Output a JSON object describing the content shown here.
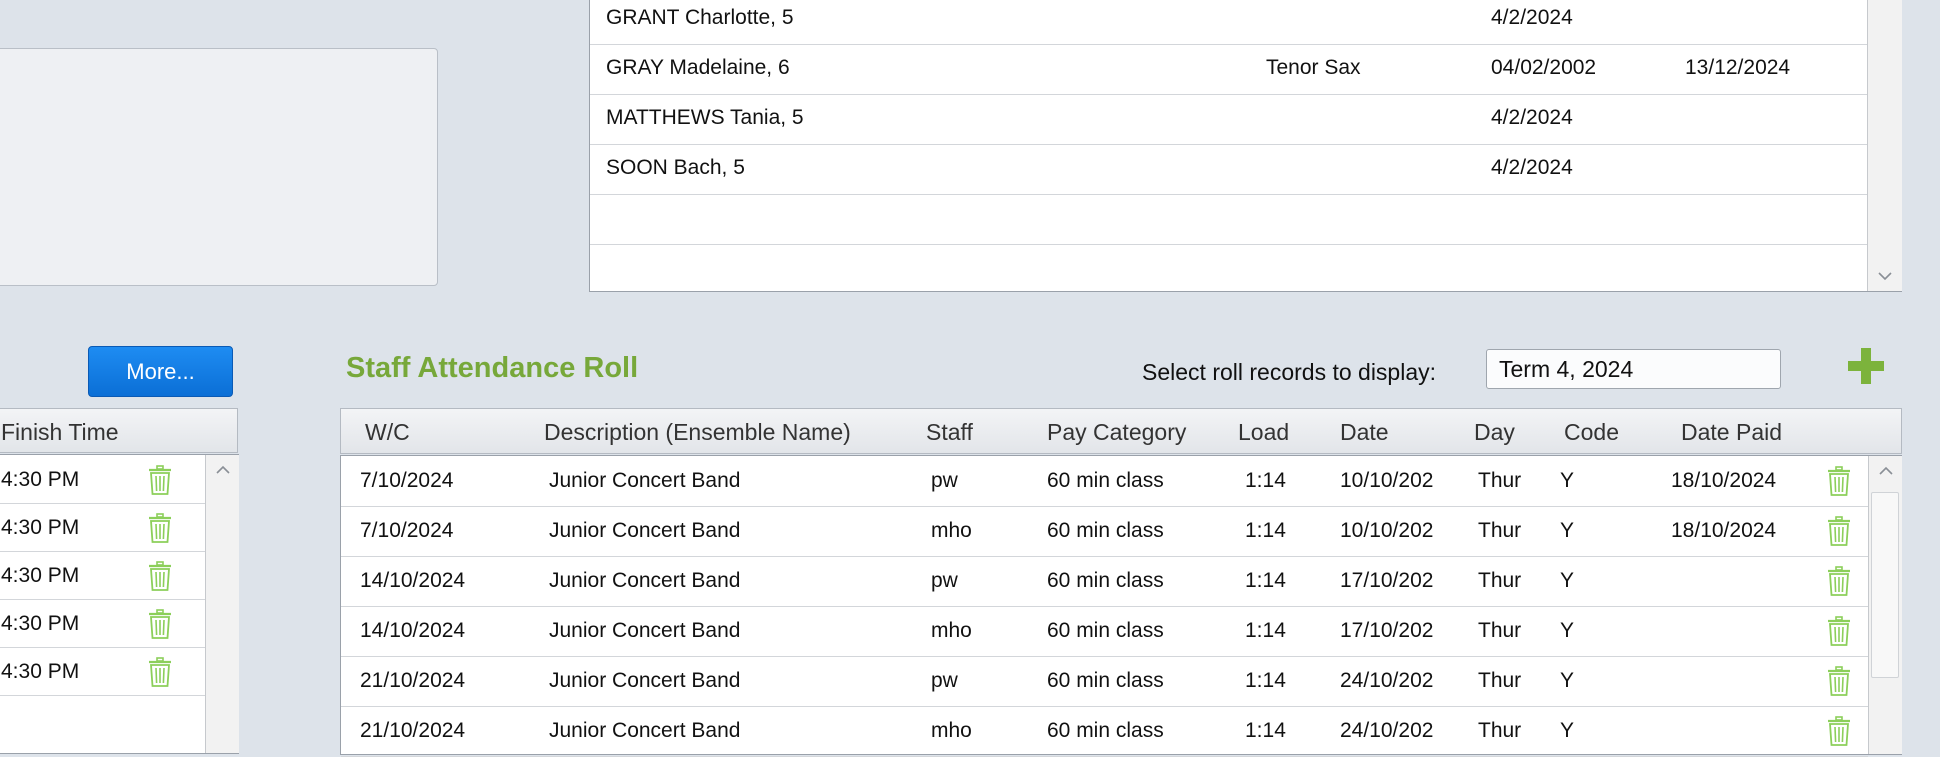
{
  "students": [
    {
      "name": "GRANT Charlotte, 5",
      "instrument": "",
      "start": "4/2/2024",
      "end": ""
    },
    {
      "name": "GRAY Madelaine, 6",
      "instrument": "Tenor Sax",
      "start": "04/02/2002",
      "end": "13/12/2024"
    },
    {
      "name": "MATTHEWS Tania, 5",
      "instrument": "",
      "start": "4/2/2024",
      "end": ""
    },
    {
      "name": "SOON Bach, 5",
      "instrument": "",
      "start": "4/2/2024",
      "end": ""
    }
  ],
  "more_button": "More...",
  "section_title": "Staff Attendance Roll",
  "filter": {
    "label": "Select roll records to display:",
    "value": "Term 4, 2024"
  },
  "left_table": {
    "header": "Finish Time",
    "rows": [
      "4:30 PM",
      "4:30 PM",
      "4:30 PM",
      "4:30 PM",
      "4:30 PM"
    ]
  },
  "roll_table": {
    "headers": [
      "W/C",
      "Description (Ensemble Name)",
      "Staff",
      "Pay Category",
      "Load",
      "Date",
      "Day",
      "Code",
      "Date Paid"
    ],
    "rows": [
      {
        "wc": "7/10/2024",
        "desc": "Junior Concert Band",
        "staff": "pw",
        "pay": "60 min class",
        "load": "1:14",
        "date": "10/10/202",
        "day": "Thur",
        "code": "Y",
        "paid": "18/10/2024"
      },
      {
        "wc": "7/10/2024",
        "desc": "Junior Concert Band",
        "staff": "mho",
        "pay": "60 min class",
        "load": "1:14",
        "date": "10/10/202",
        "day": "Thur",
        "code": "Y",
        "paid": "18/10/2024"
      },
      {
        "wc": "14/10/2024",
        "desc": "Junior Concert Band",
        "staff": "pw",
        "pay": "60 min class",
        "load": "1:14",
        "date": "17/10/202",
        "day": "Thur",
        "code": "Y",
        "paid": ""
      },
      {
        "wc": "14/10/2024",
        "desc": "Junior Concert Band",
        "staff": "mho",
        "pay": "60 min class",
        "load": "1:14",
        "date": "17/10/202",
        "day": "Thur",
        "code": "Y",
        "paid": ""
      },
      {
        "wc": "21/10/2024",
        "desc": "Junior Concert Band",
        "staff": "pw",
        "pay": "60 min class",
        "load": "1:14",
        "date": "24/10/202",
        "day": "Thur",
        "code": "Y",
        "paid": ""
      },
      {
        "wc": "21/10/2024",
        "desc": "Junior Concert Band",
        "staff": "mho",
        "pay": "60 min class",
        "load": "1:14",
        "date": "24/10/202",
        "day": "Thur",
        "code": "Y",
        "paid": ""
      }
    ]
  },
  "colors": {
    "accent_green": "#77a83a",
    "button_blue": "#0b6fd6",
    "trash_green": "#8ccf5a"
  },
  "icons": {
    "trash": "trash-icon",
    "add": "plus-icon",
    "scroll_up": "chevron-up-icon",
    "scroll_down": "chevron-down-icon"
  }
}
